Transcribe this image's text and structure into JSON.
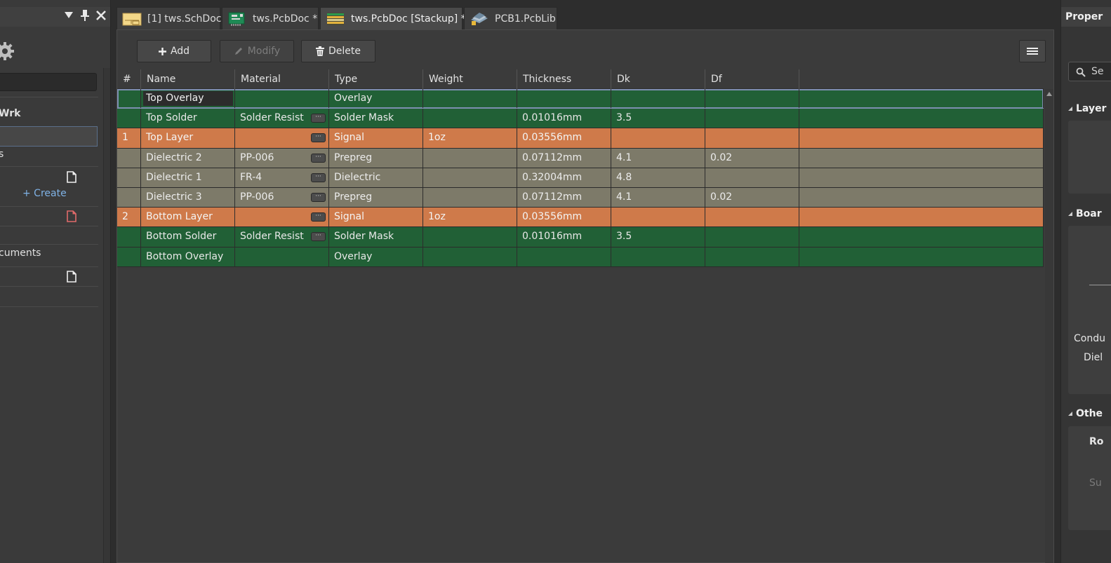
{
  "left_panel": {
    "project_label": "Wrk",
    "row_s": "s",
    "create_label": "+ Create",
    "documents_label": "cuments"
  },
  "tabs": [
    {
      "label": "[1] tws.SchDoc",
      "icon": "schematic-doc-icon"
    },
    {
      "label": "tws.PcbDoc *",
      "icon": "pcb-doc-icon"
    },
    {
      "label": "tws.PcbDoc [Stackup] *",
      "icon": "stackup-doc-icon"
    },
    {
      "label": "PCB1.PcbLib",
      "icon": "pcb-lib-icon"
    }
  ],
  "toolbar": {
    "add_label": "Add",
    "modify_label": "Modify",
    "delete_label": "Delete"
  },
  "table": {
    "columns": [
      "#",
      "Name",
      "Material",
      "Type",
      "Weight",
      "Thickness",
      "Dk",
      "Df"
    ],
    "rows": [
      {
        "num": "",
        "name": "Top Overlay",
        "material": "",
        "type": "Overlay",
        "weight": "",
        "thickness": "",
        "dk": "",
        "df": "",
        "kind": "overlay",
        "selected": true,
        "mat_button": false
      },
      {
        "num": "",
        "name": "Top Solder",
        "material": "Solder Resist",
        "type": "Solder Mask",
        "weight": "",
        "thickness": "0.01016mm",
        "dk": "3.5",
        "df": "",
        "kind": "mask",
        "mat_button": true
      },
      {
        "num": "1",
        "name": "Top Layer",
        "material": "",
        "type": "Signal",
        "weight": "1oz",
        "thickness": "0.03556mm",
        "dk": "",
        "df": "",
        "kind": "signal",
        "mat_button": true
      },
      {
        "num": "",
        "name": "Dielectric 2",
        "material": "PP-006",
        "type": "Prepreg",
        "weight": "",
        "thickness": "0.07112mm",
        "dk": "4.1",
        "df": "0.02",
        "kind": "diel",
        "mat_button": true
      },
      {
        "num": "",
        "name": "Dielectric 1",
        "material": "FR-4",
        "type": "Dielectric",
        "weight": "",
        "thickness": "0.32004mm",
        "dk": "4.8",
        "df": "",
        "kind": "diel",
        "mat_button": true
      },
      {
        "num": "",
        "name": "Dielectric 3",
        "material": "PP-006",
        "type": "Prepreg",
        "weight": "",
        "thickness": "0.07112mm",
        "dk": "4.1",
        "df": "0.02",
        "kind": "diel",
        "mat_button": true
      },
      {
        "num": "2",
        "name": "Bottom Layer",
        "material": "",
        "type": "Signal",
        "weight": "1oz",
        "thickness": "0.03556mm",
        "dk": "",
        "df": "",
        "kind": "signal",
        "mat_button": true
      },
      {
        "num": "",
        "name": "Bottom Solder",
        "material": "Solder Resist",
        "type": "Solder Mask",
        "weight": "",
        "thickness": "0.01016mm",
        "dk": "3.5",
        "df": "",
        "kind": "mask",
        "mat_button": true
      },
      {
        "num": "",
        "name": "Bottom Overlay",
        "material": "",
        "type": "Overlay",
        "weight": "",
        "thickness": "",
        "dk": "",
        "df": "",
        "kind": "overlay",
        "mat_button": false
      }
    ]
  },
  "right_panel": {
    "title": "Proper",
    "search_text": "Se",
    "sections": [
      "Layer",
      "Boar",
      "Othe"
    ],
    "conductor_label": "Condu",
    "dielectric_label": "Diel",
    "ro_label": "Ro",
    "su_label": "Su"
  },
  "colors": {
    "overlay_mask_row": "#216036",
    "signal_row": "#cf7a4a",
    "dielectric_row": "#7d7a69",
    "link": "#7fb2e5"
  }
}
